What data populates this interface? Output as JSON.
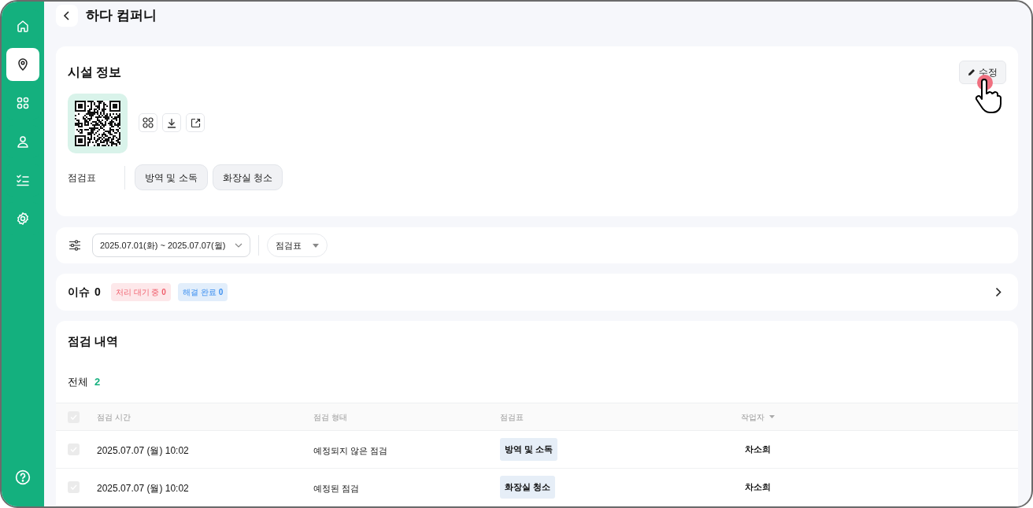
{
  "sidebar": {
    "items": [
      {
        "kind": "home",
        "selected": false
      },
      {
        "kind": "location",
        "selected": true
      },
      {
        "kind": "grid",
        "selected": false
      },
      {
        "kind": "user",
        "selected": false
      },
      {
        "kind": "checklist",
        "selected": false
      },
      {
        "kind": "settings",
        "selected": false
      }
    ],
    "help": {
      "kind": "help"
    }
  },
  "header": {
    "title": "하다 컴퍼니"
  },
  "facility": {
    "title": "시설 정보",
    "edit_button": "수정",
    "checklist_label": "점검표",
    "checklists": [
      "방역 및 소독",
      "화장실 청소"
    ]
  },
  "filters": {
    "date_range": "2025.07.01(화) ~ 2025.07.07(월)",
    "checklist_filter": "점검표"
  },
  "issues": {
    "label": "이슈",
    "count": "0",
    "badges": [
      {
        "kind": "pending",
        "label": "처리 대기 중",
        "count": "0"
      },
      {
        "kind": "resolved",
        "label": "해결 완료",
        "count": "0"
      }
    ]
  },
  "history": {
    "title": "점검 내역",
    "total_label": "전체",
    "total_count": "2",
    "table": {
      "header_checked": false,
      "columns": [
        "점검 시간",
        "점검 형태",
        "점검표",
        "작업자"
      ],
      "rows": [
        {
          "checked": false,
          "time": "2025.07.07 (월) 10:02",
          "type": "예정되지 않은 점검",
          "checklist": "방역 및 소독",
          "worker": "차소희"
        },
        {
          "checked": false,
          "time": "2025.07.07 (월) 10:02",
          "type": "예정된 점검",
          "checklist": "화장실 청소",
          "worker": "차소희"
        }
      ]
    }
  }
}
